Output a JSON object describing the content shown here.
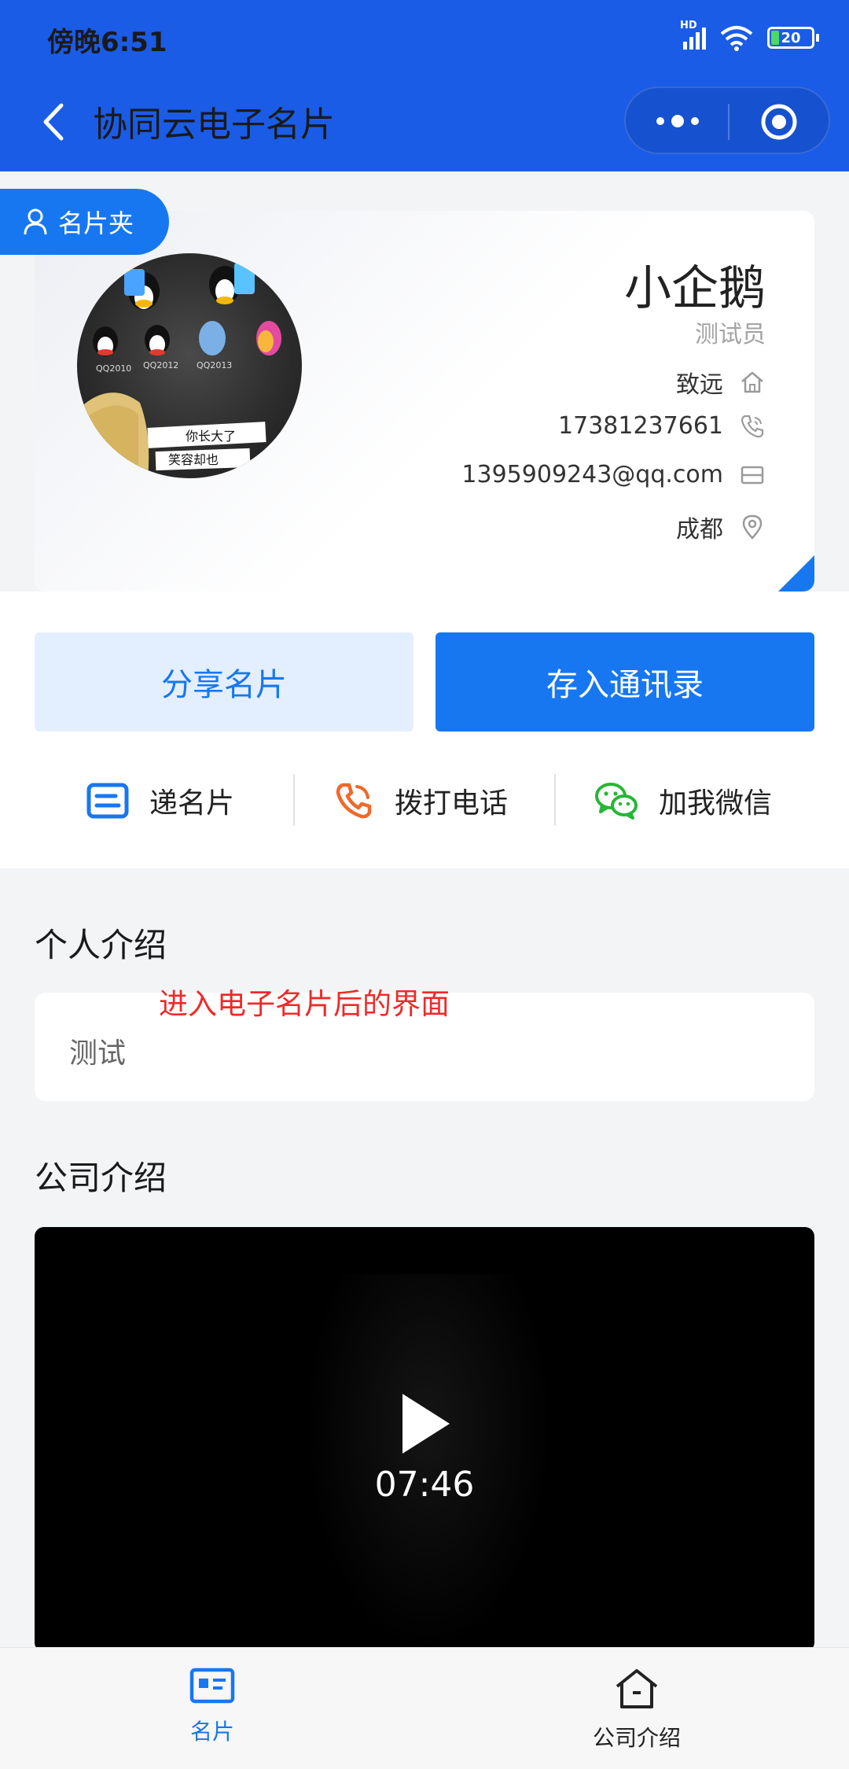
{
  "status_bar": {
    "time": "傍晚6:51",
    "network": "HD",
    "battery": "20"
  },
  "nav": {
    "title": "协同云电子名片",
    "more_icon": "more-dots-icon",
    "close_icon": "target-circle-icon"
  },
  "card": {
    "folder_label": "名片夹",
    "name": "小企鹅",
    "role": "测试员",
    "company": "致远",
    "phone": "17381237661",
    "email": "1395909243@qq.com",
    "city": "成都",
    "avatar_texts": [
      "QQ2010",
      "QQ2012",
      "QQ2013",
      "你长大了",
      "笑容却也"
    ]
  },
  "actions": {
    "share_label": "分享名片",
    "save_label": "存入通讯录",
    "quick": [
      {
        "label": "递名片",
        "icon": "card-icon",
        "color": "#1777f0"
      },
      {
        "label": "拨打电话",
        "icon": "phone-icon",
        "color": "#f0682b"
      },
      {
        "label": "加我微信",
        "icon": "wechat-icon",
        "color": "#28b637"
      }
    ]
  },
  "sections": {
    "intro_title": "个人介绍",
    "intro_text": "测试",
    "annotation": "进入电子名片后的界面",
    "company_title": "公司介绍",
    "video_duration": "07:46"
  },
  "tabbar": {
    "items": [
      {
        "label": "名片",
        "icon": "card-tab-icon",
        "active": true
      },
      {
        "label": "公司介绍",
        "icon": "home-tab-icon",
        "active": false
      }
    ],
    "active_color": "#1777f0"
  }
}
